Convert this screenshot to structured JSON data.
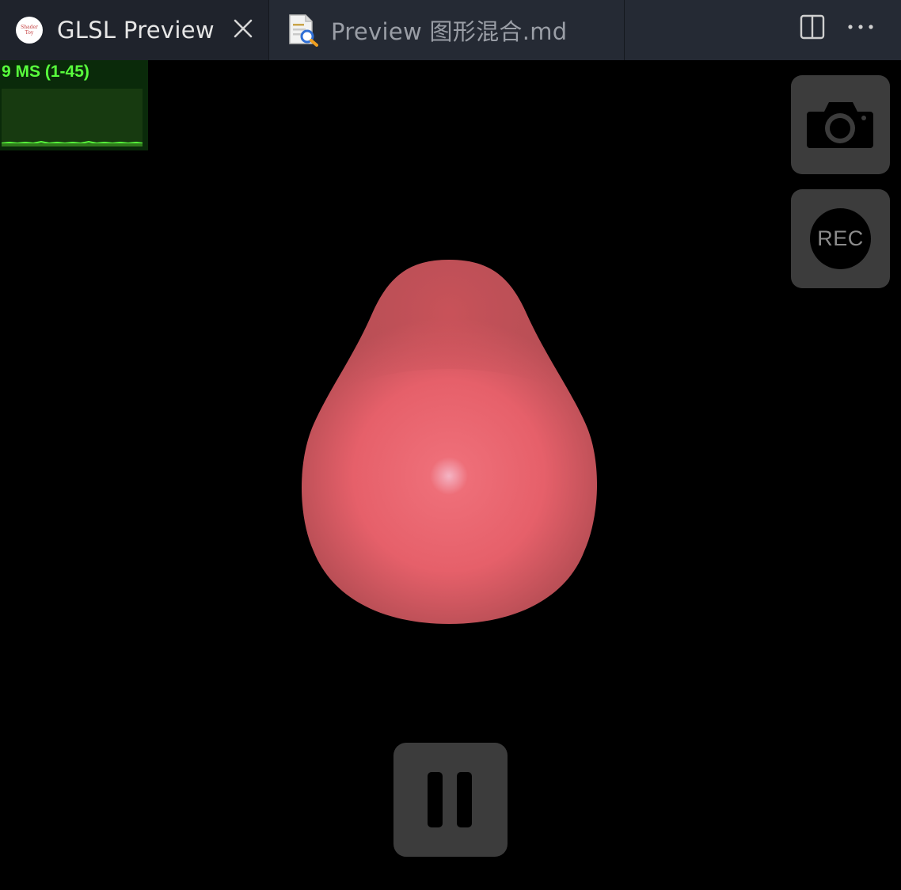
{
  "tabs": [
    {
      "label": "GLSL Preview",
      "icon": "shader-toy-logo-icon",
      "active": true
    },
    {
      "label": "Preview 图形混合.md",
      "icon": "markdown-preview-icon",
      "active": false
    }
  ],
  "tab_logo_text": "Shader Toy",
  "stats": {
    "label": "9 MS (1-45)"
  },
  "controls": {
    "rec_label": "REC"
  },
  "colors": {
    "tabbar_bg": "#252a34",
    "active_tab_bg": "#1f232c",
    "stats_text": "#58ff3c",
    "blob_color": "#e8626a",
    "button_bg": "#3c3c3c"
  }
}
